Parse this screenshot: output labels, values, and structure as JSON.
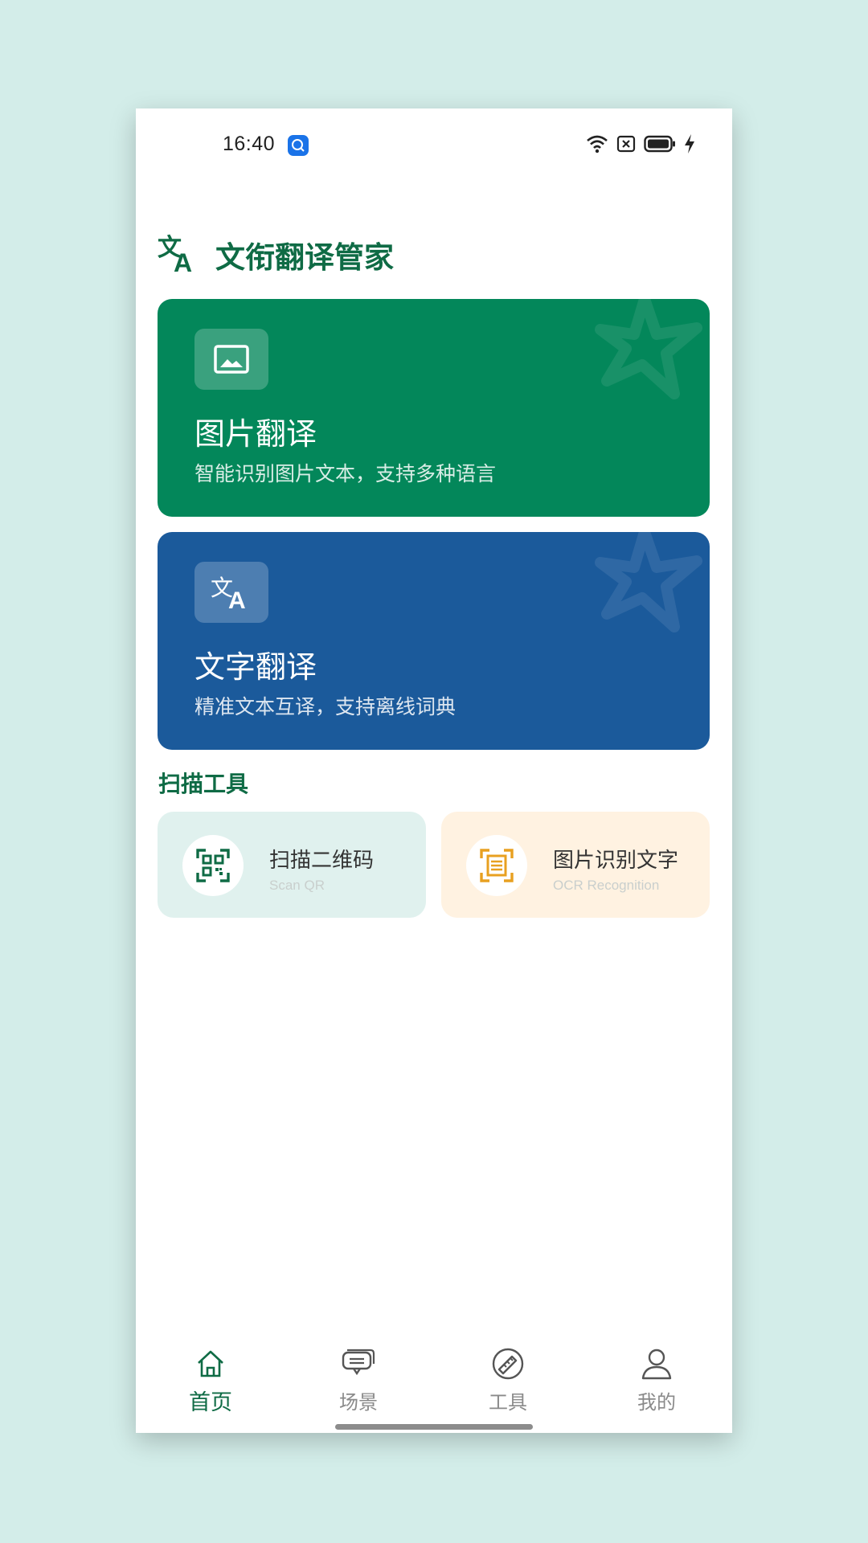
{
  "status_bar": {
    "time": "16:40",
    "icons": [
      "app-notification-icon",
      "wifi-icon",
      "sim-off-icon",
      "battery-icon",
      "charging-icon"
    ]
  },
  "header": {
    "app_title": "文衔翻译管家",
    "logo_icon": "translate-icon"
  },
  "feature_cards": [
    {
      "title": "图片翻译",
      "subtitle": "智能识别图片文本，支持多种语言",
      "icon": "image-icon",
      "color": "#03875a"
    },
    {
      "title": "文字翻译",
      "subtitle": "精准文本互译，支持离线词典",
      "icon": "translate-icon",
      "color": "#1b5a9b"
    }
  ],
  "scan_tools": {
    "section_title": "扫描工具",
    "items": [
      {
        "title": "扫描二维码",
        "subtitle": "Scan QR",
        "icon": "qr-scan-icon",
        "bg": "#e0f1ee"
      },
      {
        "title": "图片识别文字",
        "subtitle": "OCR Recognition",
        "icon": "ocr-scan-icon",
        "bg": "#fff2e1"
      }
    ]
  },
  "bottom_nav": {
    "active_index": 0,
    "items": [
      {
        "label": "首页",
        "icon": "home-icon"
      },
      {
        "label": "场景",
        "icon": "chat-bubbles-icon"
      },
      {
        "label": "工具",
        "icon": "ruler-pencil-icon"
      },
      {
        "label": "我的",
        "icon": "person-icon"
      }
    ]
  },
  "colors": {
    "brand_green": "#0f6b45",
    "image_card": "#03875a",
    "text_card": "#1b5a9b",
    "page_background": "#d3ede9"
  }
}
